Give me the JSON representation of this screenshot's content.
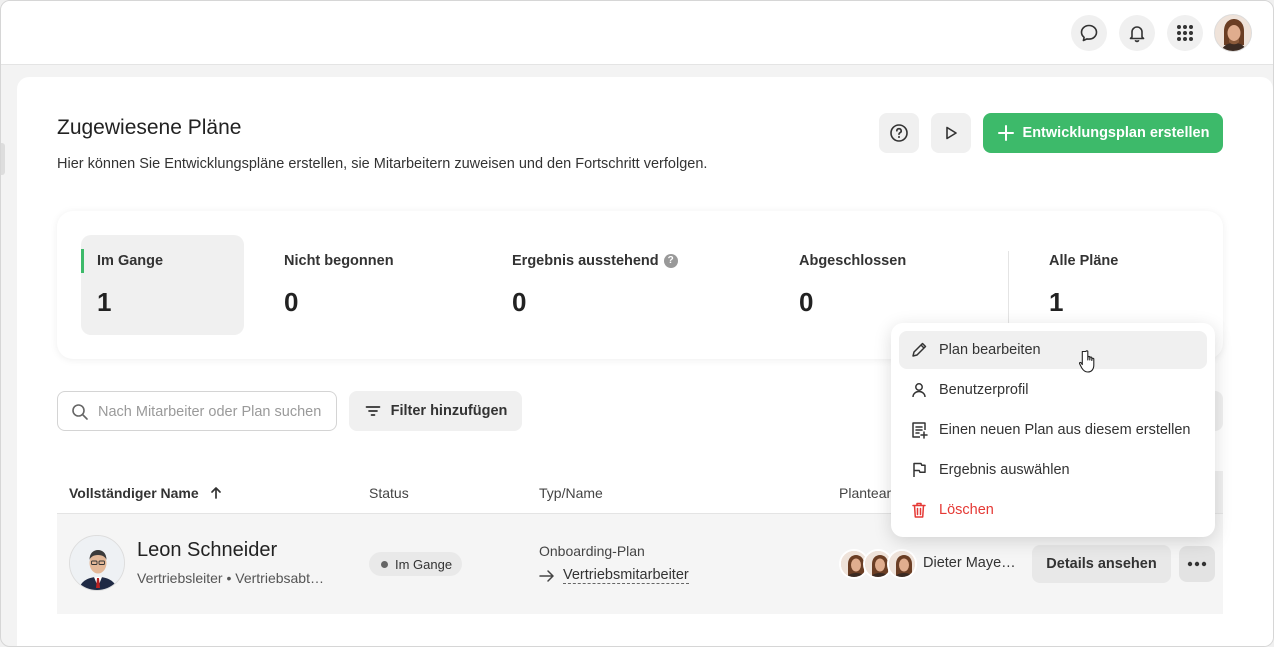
{
  "topbar": {
    "icons": [
      "chat-icon",
      "bell-icon",
      "apps-grid-icon"
    ]
  },
  "header": {
    "title": "Zugewiesene Pläne",
    "subtitle": "Hier können Sie Entwicklungspläne erstellen, sie Mitarbeitern zuweisen und den Fortschritt verfolgen.",
    "create_label": "Entwicklungsplan erstellen"
  },
  "stats": [
    {
      "label": "Im Gange",
      "value": "1"
    },
    {
      "label": "Nicht begonnen",
      "value": "0"
    },
    {
      "label": "Ergebnis ausstehend",
      "value": "0"
    },
    {
      "label": "Abgeschlossen",
      "value": "0"
    },
    {
      "label": "Alle Pläne",
      "value": "1"
    }
  ],
  "search": {
    "placeholder": "Nach Mitarbeiter oder Plan suchen"
  },
  "filter_label": "Filter hinzufügen",
  "table": {
    "columns": [
      "Vollständiger Name",
      "Status",
      "Typ/Name",
      "Planteam"
    ],
    "rows": [
      {
        "name": "Leon Schneider",
        "subtitle": "Vertriebsleiter • Vertriebsabt…",
        "status": "Im Gange",
        "plan_type": "Onboarding-Plan",
        "plan_name": "Vertriebsmitarbeiter",
        "team_name": "Dieter Maye…",
        "details_label": "Details ansehen"
      }
    ]
  },
  "menu": {
    "items": [
      {
        "label": "Plan bearbeiten"
      },
      {
        "label": "Benutzerprofil"
      },
      {
        "label": "Einen neuen Plan aus diesem erstellen"
      },
      {
        "label": "Ergebnis auswählen"
      },
      {
        "label": "Löschen"
      }
    ]
  },
  "colors": {
    "accent": "#3dba6a",
    "danger": "#e53935"
  }
}
